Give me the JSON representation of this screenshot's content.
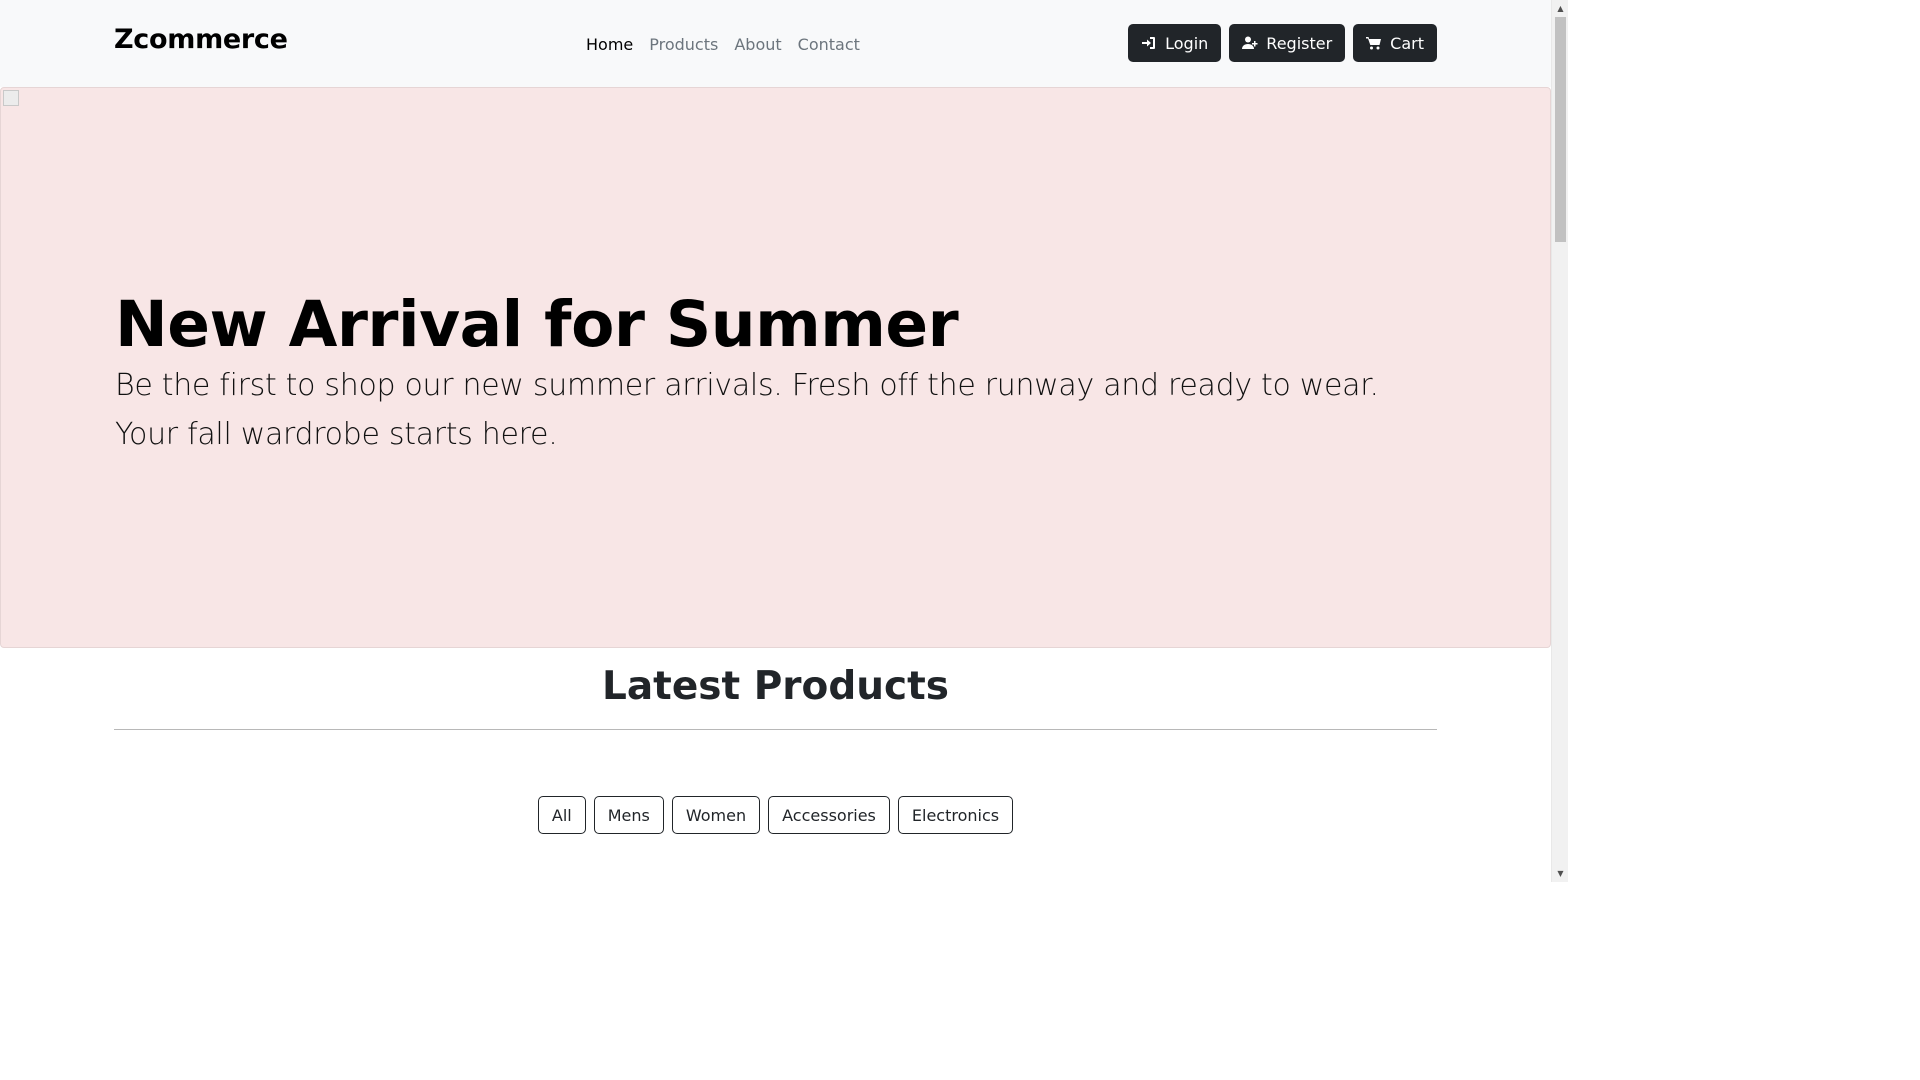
{
  "navbar": {
    "brand": "Zcommerce",
    "links": [
      {
        "label": "Home",
        "active": true
      },
      {
        "label": "Products",
        "active": false
      },
      {
        "label": "About",
        "active": false
      },
      {
        "label": "Contact",
        "active": false
      }
    ],
    "actions": [
      {
        "label": "Login",
        "icon": "sign-in-icon"
      },
      {
        "label": "Register",
        "icon": "user-plus-icon"
      },
      {
        "label": "Cart",
        "icon": "cart-icon"
      }
    ]
  },
  "hero": {
    "title": "New Arrival for Summer",
    "text": "Be the first to shop our new summer arrivals. Fresh off the runway and ready to wear. Your fall wardrobe starts here."
  },
  "products": {
    "title": "Latest Products",
    "filters": [
      "All",
      "Mens",
      "Women",
      "Accessories",
      "Electronics"
    ]
  },
  "colors": {
    "navbar_bg": "#f8f9fa",
    "hero_bg": "#f8e6e6",
    "button_dark": "#212529"
  }
}
